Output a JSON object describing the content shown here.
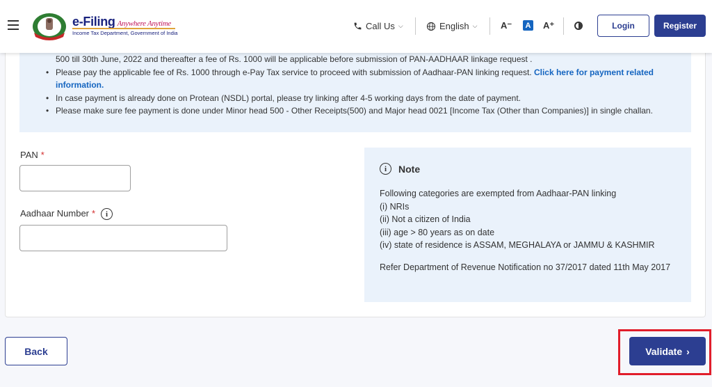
{
  "header": {
    "brand_title": "e-Filing",
    "brand_tagline": "Anywhere Anytime",
    "brand_subtitle": "Income Tax Department, Government of India",
    "call_us": "Call Us",
    "language": "English",
    "font_decrease": "A⁻",
    "font_default": "A",
    "font_increase": "A⁺",
    "login": "Login",
    "register": "Register"
  },
  "info": {
    "line1": "500 till 30th June, 2022 and thereafter a fee of Rs. 1000 will be applicable before submission of PAN-AADHAAR linkage request .",
    "line2_text": "Please pay the applicable fee of Rs. 1000 through e-Pay Tax service to proceed with submission of Aadhaar-PAN linking request. ",
    "line2_link": "Click here for payment related information.",
    "line3": "In case payment is already done on Protean (NSDL) portal, please try linking after 4-5 working days from the date of payment.",
    "line4": "Please make sure fee payment is done under Minor head 500 - Other Receipts(500) and Major head 0021 [Income Tax (Other than Companies)] in single challan."
  },
  "form": {
    "pan_label": "PAN",
    "pan_value": "",
    "aadhaar_label": "Aadhaar Number",
    "aadhaar_value": "",
    "required_mark": "*"
  },
  "note": {
    "title": "Note",
    "intro": "Following categories are exempted from Aadhaar-PAN linking",
    "items": [
      "(i) NRIs",
      "(ii) Not a citizen of India",
      "(iii) age > 80 years as on date",
      "(iv) state of residence is ASSAM, MEGHALAYA or JAMMU & KASHMIR"
    ],
    "reference": "Refer Department of Revenue Notification no 37/2017 dated 11th May 2017"
  },
  "actions": {
    "back": "Back",
    "validate": "Validate",
    "validate_chevron": "›"
  },
  "colors": {
    "primary": "#2c3e91",
    "link": "#1565c0",
    "highlight": "#e11d2a",
    "info_bg": "#eaf2fb"
  }
}
